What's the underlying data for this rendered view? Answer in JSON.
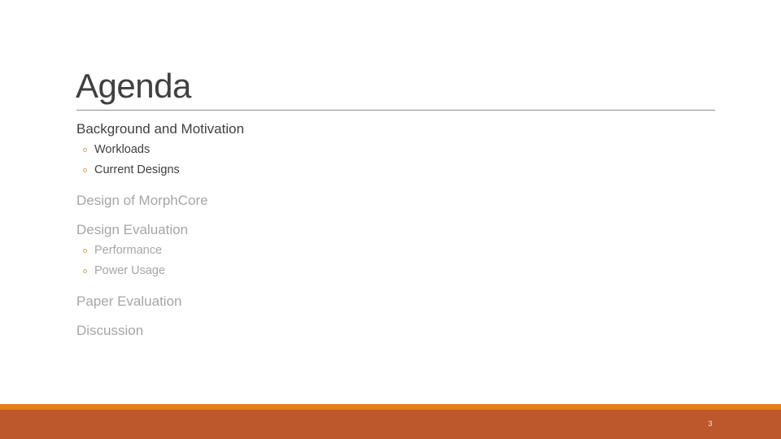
{
  "slide": {
    "title": "Agenda",
    "page_number": "3",
    "colors": {
      "accent_strip": "#e07f1c",
      "footer_band": "#bd582c",
      "active_text": "#404040",
      "dim_text": "#a6a6a6"
    },
    "items": [
      {
        "label": "Background and Motivation",
        "state": "active",
        "subitems": [
          {
            "label": "Workloads"
          },
          {
            "label": "Current Designs"
          }
        ]
      },
      {
        "label": "Design of MorphCore",
        "state": "dim",
        "subitems": []
      },
      {
        "label": "Design Evaluation",
        "state": "dim",
        "subitems": [
          {
            "label": "Performance"
          },
          {
            "label": "Power Usage"
          }
        ]
      },
      {
        "label": "Paper Evaluation",
        "state": "dim",
        "subitems": []
      },
      {
        "label": "Discussion",
        "state": "dim",
        "subitems": []
      }
    ]
  }
}
